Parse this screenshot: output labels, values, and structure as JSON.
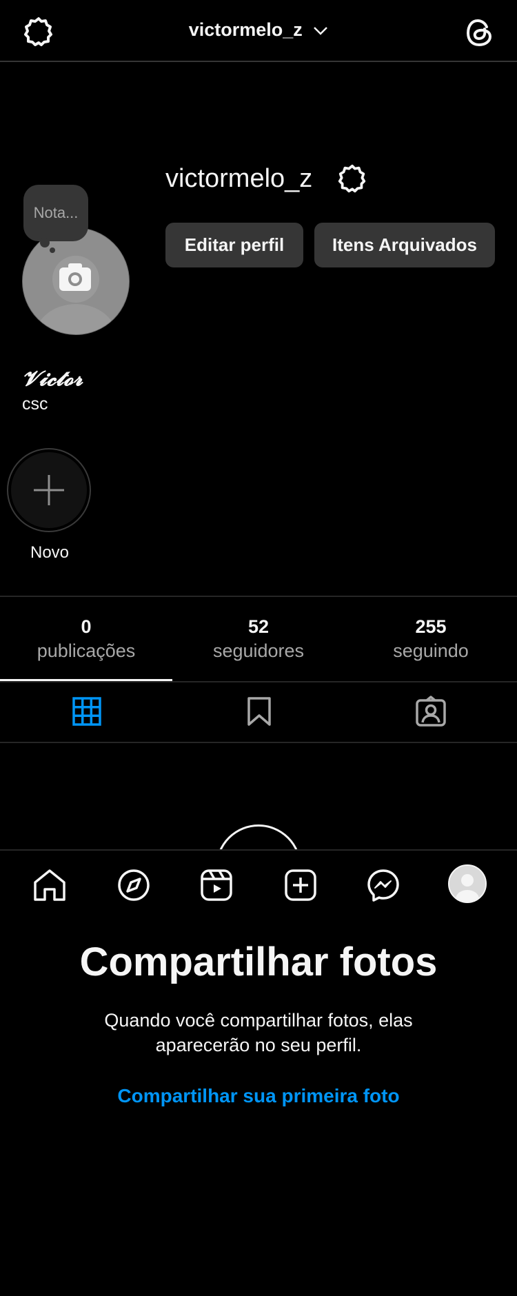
{
  "header": {
    "username": "victormelo_z",
    "icons": [
      "settings-icon",
      "chevron-down-icon",
      "threads-icon"
    ]
  },
  "profile": {
    "username": "victormelo_z",
    "note_placeholder": "Nota...",
    "edit_button_label": "Editar perfil",
    "archived_button_label": "Itens Arquivados",
    "display_name": "𝓥𝓲𝓬𝓽𝓸𝓻",
    "bio": "csc"
  },
  "highlights": {
    "new_label": "Novo"
  },
  "stats": [
    {
      "count": "0",
      "label": "publicações"
    },
    {
      "count": "52",
      "label": "seguidores"
    },
    {
      "count": "255",
      "label": "seguindo"
    }
  ],
  "tabs": [
    "grid-icon",
    "bookmark-icon",
    "tagged-icon"
  ],
  "bottom_nav": [
    "home-icon",
    "explore-icon",
    "reels-icon",
    "new-post-icon",
    "messenger-icon",
    "profile-avatar"
  ],
  "empty_state": {
    "title": "Compartilhar fotos",
    "text": "Quando você compartilhar fotos, elas aparecerão no seu perfil.",
    "link": "Compartilhar sua primeira foto"
  },
  "colors": {
    "background": "#000000",
    "button": "#363636",
    "link": "#0095f6",
    "active_tab": "#0095f6",
    "divider": "#262626"
  }
}
